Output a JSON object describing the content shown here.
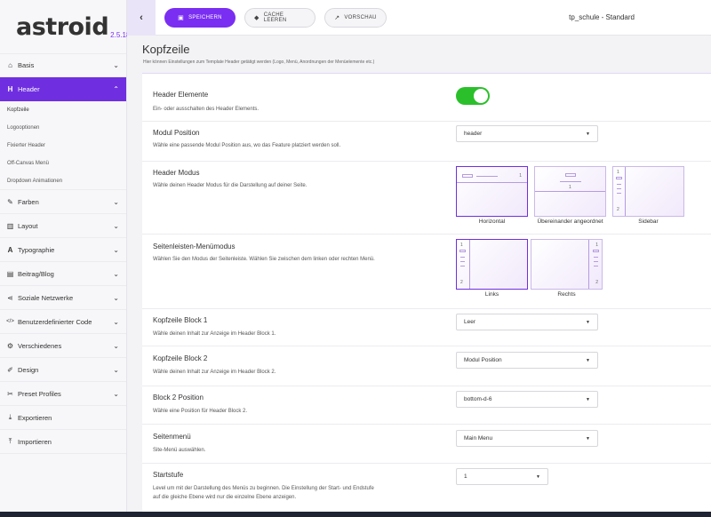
{
  "logo": {
    "text": "astroid",
    "version": "2.5.18"
  },
  "sidebar": {
    "items": [
      {
        "label": "Basis",
        "icon": "home-icon"
      },
      {
        "label": "Header",
        "icon": "heading-icon",
        "active": true,
        "children": [
          "Kopfzeile",
          "Logooptionen",
          "Fixierter Header",
          "Off-Canvas Menü",
          "Dropdown Animationen"
        ]
      },
      {
        "label": "Farben",
        "icon": "brush-icon"
      },
      {
        "label": "Layout",
        "icon": "columns-icon"
      },
      {
        "label": "Typographie",
        "icon": "font-icon"
      },
      {
        "label": "Beitrag/Blog",
        "icon": "blog-icon"
      },
      {
        "label": "Soziale Netzwerke",
        "icon": "share-icon"
      },
      {
        "label": "Benutzerdefinierter Code",
        "icon": "code-icon"
      },
      {
        "label": "Verschiedenes",
        "icon": "cogs-icon"
      },
      {
        "label": "Design",
        "icon": "paint-icon"
      },
      {
        "label": "Preset Profiles",
        "icon": "wrench-icon"
      },
      {
        "label": "Exportieren",
        "icon": "download-icon"
      },
      {
        "label": "Importieren",
        "icon": "upload-icon"
      }
    ]
  },
  "toolbar": {
    "back_icon": "chevron-left-icon",
    "save_label": "SPEICHERN",
    "cache_label": "CACHE LEEREN",
    "preview_label": "VORSCHAU",
    "template_title": "tp_schule - Standard"
  },
  "section": {
    "title": "Kopfzeile",
    "description": "Hier können Einstellungen zum Template Header getätigt werden (Logo, Menü, Anordnungen der Menüelemente etc.)"
  },
  "fields": {
    "header_elements": {
      "label": "Header Elemente",
      "desc": "Ein- oder ausschalten des Header Elements.",
      "enabled": true
    },
    "modul_position": {
      "label": "Modul Position",
      "desc": "Wähle eine passende Modul Position aus, wo das Feature platziert werden soll.",
      "value": "header"
    },
    "header_modus": {
      "label": "Header Modus",
      "desc": "Wähle deinen Header Modus für die Darstellung auf deiner Seite.",
      "options": [
        "Horizontal",
        "Übereinander angeordnet",
        "Sidebar"
      ],
      "selected": "Horizontal"
    },
    "seitenleisten": {
      "label": "Seitenleisten-Menümodus",
      "desc": "Wählen Sie den Modus der Seitenleiste. Wählen Sie zwischen dem linken oder rechten Menü.",
      "options": [
        "Links",
        "Rechts"
      ],
      "selected": "Links"
    },
    "block1": {
      "label": "Kopfzeile Block 1",
      "desc": "Wähle deinen Inhalt zur Anzeige im Header Block 1.",
      "value": "Leer"
    },
    "block2": {
      "label": "Kopfzeile Block 2",
      "desc": "Wähle deinen Inhalt zur Anzeige im Header Block 2.",
      "value": "Modul Position"
    },
    "block2_position": {
      "label": "Block 2 Position",
      "desc": "Wähle eine Position für Header Block 2.",
      "value": "bottom-d-6"
    },
    "seitenmenu": {
      "label": "Seitenmenü",
      "desc": "Site-Menü auswählen.",
      "value": "Main Menu"
    },
    "startstufe": {
      "label": "Startstufe",
      "desc1": "Level um mit der Darstellung des Menüs zu beginnen. Die Einstellung der Start- und Endstufe",
      "desc2": "auf die gleiche Ebene wird nur die einzelne Ebene anzeigen.",
      "value": "1"
    }
  },
  "mini_markers": {
    "one": "1",
    "two": "2"
  },
  "colors": {
    "accent": "#6f2fe0",
    "toggle_on": "#2bc02b"
  }
}
